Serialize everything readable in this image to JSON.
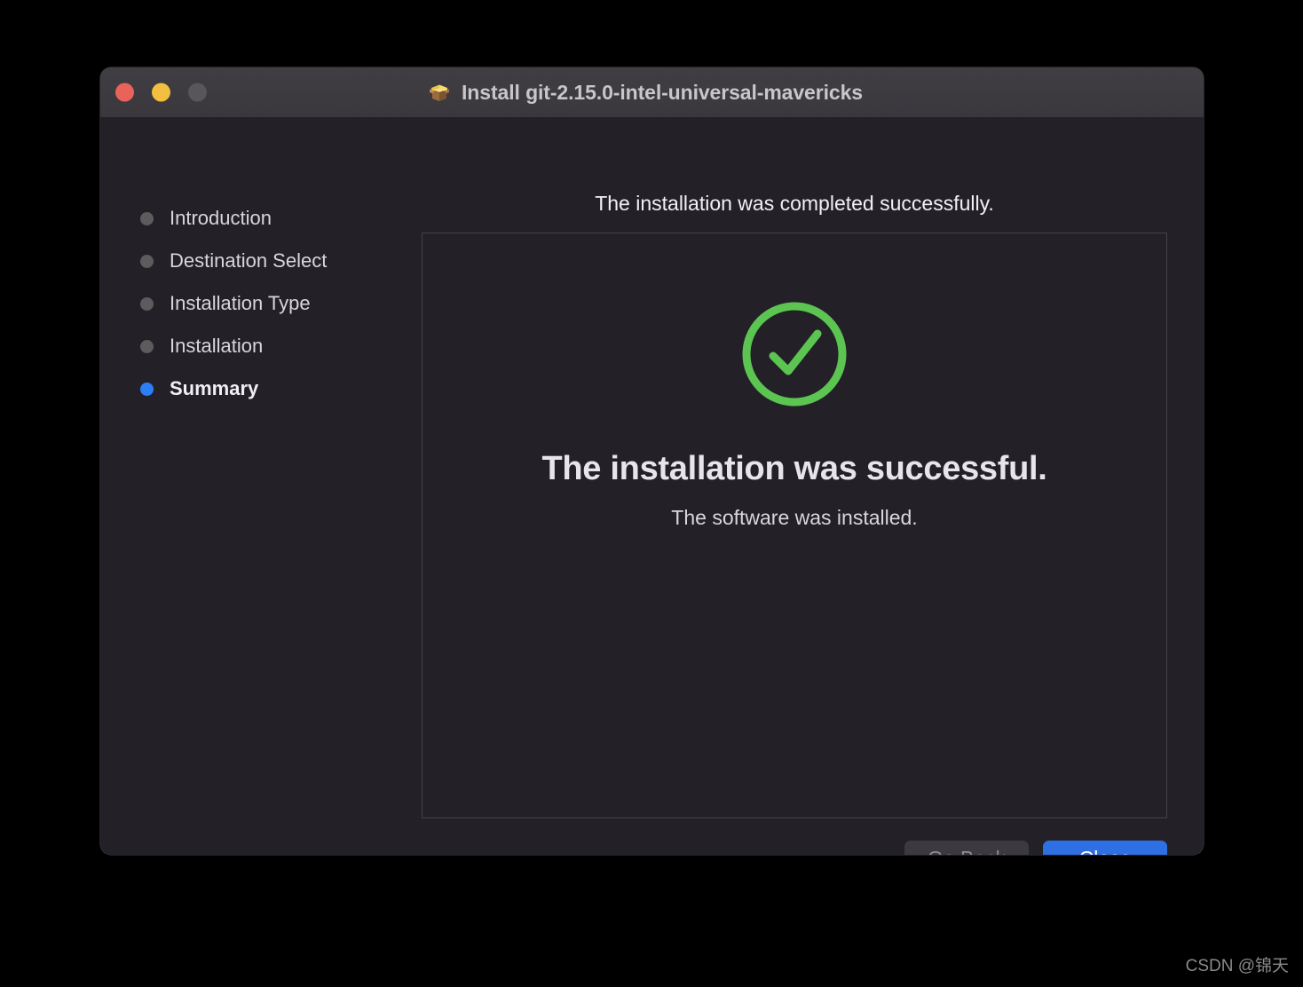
{
  "window": {
    "title": "Install git-2.15.0-intel-universal-mavericks",
    "icon": "package-box-icon",
    "traffic_lights": {
      "close": "close-window-button",
      "minimize": "minimize-window-button",
      "zoom": "zoom-window-button"
    },
    "colors": {
      "close": "#e8645a",
      "minimize": "#f2bf40",
      "zoom": "#58565b",
      "titlebar_bg": "#3b393e",
      "window_bg": "#232127",
      "panel_border": "#434248",
      "accent_blue": "#2d7ef7",
      "primary_button": "#2f6fe4",
      "success_green": "#5cc552"
    }
  },
  "sidebar": {
    "steps": [
      {
        "label": "Introduction",
        "state": "done"
      },
      {
        "label": "Destination Select",
        "state": "done"
      },
      {
        "label": "Installation Type",
        "state": "done"
      },
      {
        "label": "Installation",
        "state": "done"
      },
      {
        "label": "Summary",
        "state": "active"
      }
    ]
  },
  "main": {
    "headline": "The installation was completed successfully.",
    "status_icon": "success-check-circle-icon",
    "success_title": "The installation was successful.",
    "success_subtitle": "The software was installed."
  },
  "buttons": {
    "go_back": "Go Back",
    "go_back_disabled": true,
    "close": "Close"
  },
  "watermark": {
    "text": "CSDN @锦天"
  }
}
